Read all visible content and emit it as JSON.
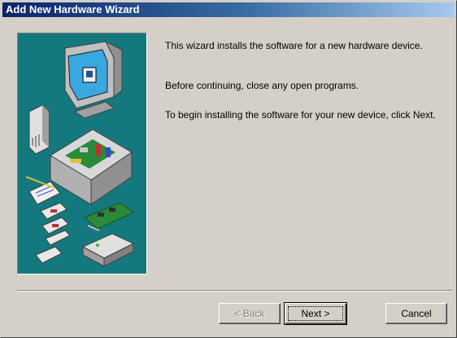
{
  "window": {
    "title": "Add New Hardware Wizard"
  },
  "illustration": {
    "background_color": "#14797e",
    "items": [
      "monitor-icon",
      "modem-icon",
      "computer-case-icon",
      "pcb-card-icon",
      "disk-icon",
      "network-hub-icon"
    ]
  },
  "content": {
    "line1": "This wizard installs the software for a new hardware device.",
    "line2": "Before continuing, close any open programs.",
    "line3": "To begin installing the software for your new device, click Next."
  },
  "buttons": {
    "back_label": "< Back",
    "next_label": "Next >",
    "cancel_label": "Cancel"
  },
  "colors": {
    "titlebar_start": "#0a246a",
    "titlebar_end": "#a6caf0",
    "face": "#d4d0c8"
  }
}
